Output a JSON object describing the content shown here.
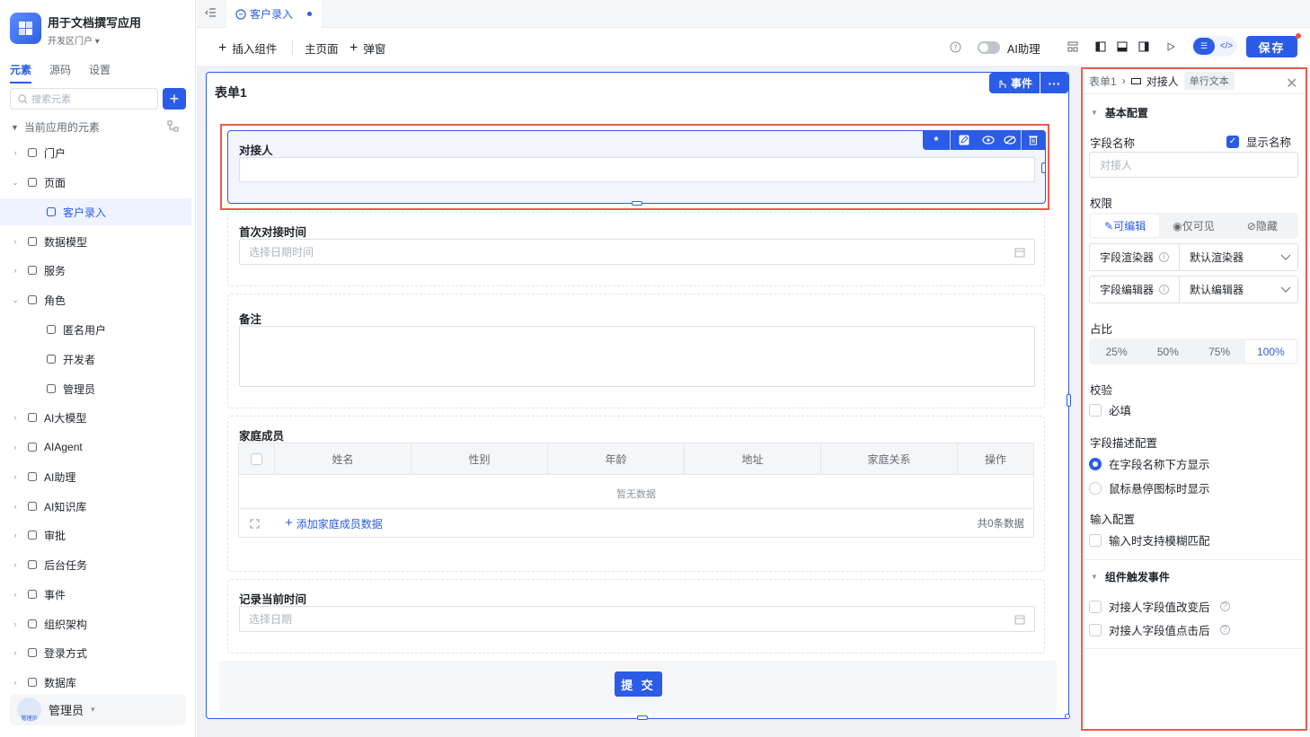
{
  "app": {
    "name": "用于文档撰写应用",
    "portal": "开发区门户"
  },
  "sidebar": {
    "tabs": [
      "元素",
      "源码",
      "设置"
    ],
    "search_placeholder": "搜索元素",
    "section_title": "当前应用的元素",
    "items": [
      {
        "label": "门户",
        "icon": "home-icon"
      },
      {
        "label": "页面",
        "icon": "page-icon"
      },
      {
        "label": "客户录入",
        "icon": "form-page-icon"
      },
      {
        "label": "数据模型",
        "icon": "table-icon"
      },
      {
        "label": "服务",
        "icon": "service-icon"
      },
      {
        "label": "角色",
        "icon": "role-icon"
      },
      {
        "label": "匿名用户",
        "icon": "user-icon"
      },
      {
        "label": "开发者",
        "icon": "user-icon"
      },
      {
        "label": "管理员",
        "icon": "user-icon"
      },
      {
        "label": "AI大模型",
        "icon": "model-icon"
      },
      {
        "label": "AIAgent",
        "icon": "robot-icon"
      },
      {
        "label": "AI助理",
        "icon": "assistant-icon"
      },
      {
        "label": "AI知识库",
        "icon": "book-icon"
      },
      {
        "label": "审批",
        "icon": "stamp-icon"
      },
      {
        "label": "后台任务",
        "icon": "task-icon"
      },
      {
        "label": "事件",
        "icon": "event-icon"
      },
      {
        "label": "组织架构",
        "icon": "org-icon"
      },
      {
        "label": "登录方式",
        "icon": "login-icon"
      },
      {
        "label": "数据库",
        "icon": "database-icon"
      }
    ],
    "user": {
      "name": "管理员",
      "avatar_text": "管理员"
    }
  },
  "tabbar": {
    "page_tab": "客户录入"
  },
  "toolbar": {
    "insert_component": "插入组件",
    "main_page": "主页面",
    "popup": "弹窗",
    "ai_assistant": "AI助理",
    "save": "保存"
  },
  "form": {
    "title": "表单1",
    "event_button": "事件",
    "more_button": "···",
    "fields": {
      "contact": {
        "label": "对接人"
      },
      "first_contact_time": {
        "label": "首次对接时间",
        "placeholder": "选择日期时间"
      },
      "remark": {
        "label": "备注"
      },
      "family": {
        "label": "家庭成员",
        "columns": [
          "姓名",
          "性别",
          "年龄",
          "地址",
          "家庭关系",
          "操作"
        ],
        "empty": "暂无数据",
        "add_link": "添加家庭成员数据",
        "total": "共0条数据"
      },
      "record_time": {
        "label": "记录当前时间",
        "placeholder": "选择日期"
      }
    },
    "submit": "提 交"
  },
  "panel": {
    "breadcrumb": {
      "root": "表单1",
      "current": "对接人",
      "type": "单行文本"
    },
    "basic_config": "基本配置",
    "field_name_label": "字段名称",
    "show_name": "显示名称",
    "field_name_placeholder": "对接人",
    "permission_label": "权限",
    "permissions": [
      "可编辑",
      "仅可见",
      "隐藏"
    ],
    "renderer": {
      "label": "字段渲染器",
      "value": "默认渲染器"
    },
    "editor": {
      "label": "字段编辑器",
      "value": "默认编辑器"
    },
    "ratio_label": "占比",
    "ratios": [
      "25%",
      "50%",
      "75%",
      "100%"
    ],
    "validation_label": "校验",
    "required": "必填",
    "desc_config_label": "字段描述配置",
    "desc_options": [
      "在字段名称下方显示",
      "鼠标悬停图标时显示"
    ],
    "input_config_label": "输入配置",
    "fuzzy_match": "输入时支持模糊匹配",
    "events_section": "组件触发事件",
    "events": [
      "对接人字段值改变后",
      "对接人字段值点击后"
    ]
  }
}
